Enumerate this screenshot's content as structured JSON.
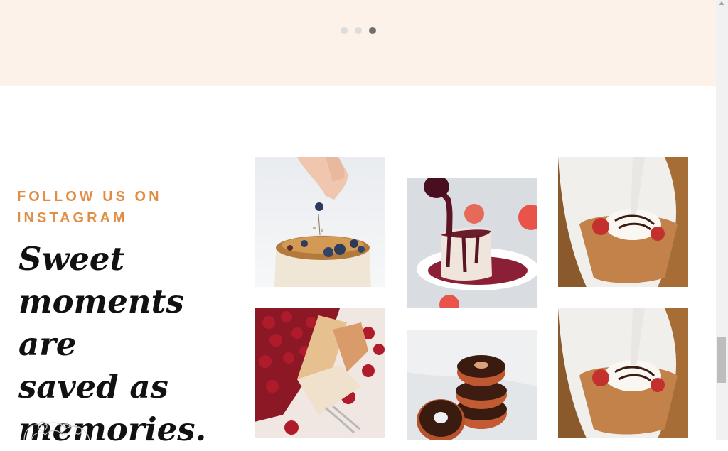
{
  "carousel": {
    "dots": [
      {
        "label": "slide-1",
        "active": false
      },
      {
        "label": "slide-2",
        "active": false
      },
      {
        "label": "slide-3",
        "active": true
      }
    ]
  },
  "instagram": {
    "eyebrow_line1": "FOLLOW US ON",
    "eyebrow_line2": "INSTAGRAM",
    "headline_lines": [
      "Sweet",
      "moments are",
      "saved as",
      "memories."
    ]
  },
  "gallery": {
    "photos": [
      {
        "icon": "blueberry-cake-photo"
      },
      {
        "icon": "cheesecake-sauce-photo"
      },
      {
        "icon": "crepe-cone-photo"
      },
      {
        "icon": "cherry-pastry-photo"
      },
      {
        "icon": "chocolate-donuts-photo"
      },
      {
        "icon": "crepe-cone-photo"
      }
    ]
  },
  "colors": {
    "accent": "#e08e45",
    "band_background": "#fdf2ea",
    "heading": "#111111"
  }
}
